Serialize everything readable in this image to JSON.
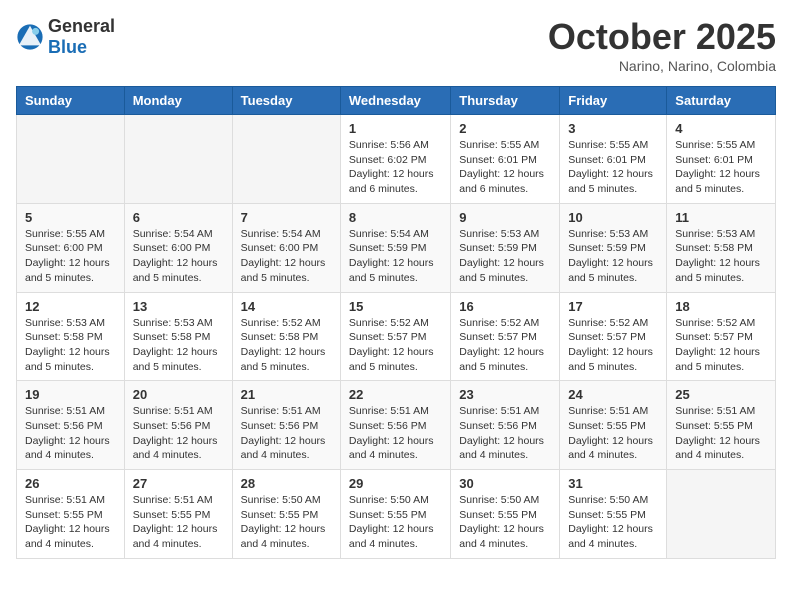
{
  "logo": {
    "text_general": "General",
    "text_blue": "Blue"
  },
  "header": {
    "month_title": "October 2025",
    "location": "Narino, Narino, Colombia"
  },
  "weekdays": [
    "Sunday",
    "Monday",
    "Tuesday",
    "Wednesday",
    "Thursday",
    "Friday",
    "Saturday"
  ],
  "weeks": [
    [
      {
        "day": "",
        "info": ""
      },
      {
        "day": "",
        "info": ""
      },
      {
        "day": "",
        "info": ""
      },
      {
        "day": "1",
        "info": "Sunrise: 5:56 AM\nSunset: 6:02 PM\nDaylight: 12 hours\nand 6 minutes."
      },
      {
        "day": "2",
        "info": "Sunrise: 5:55 AM\nSunset: 6:01 PM\nDaylight: 12 hours\nand 6 minutes."
      },
      {
        "day": "3",
        "info": "Sunrise: 5:55 AM\nSunset: 6:01 PM\nDaylight: 12 hours\nand 5 minutes."
      },
      {
        "day": "4",
        "info": "Sunrise: 5:55 AM\nSunset: 6:01 PM\nDaylight: 12 hours\nand 5 minutes."
      }
    ],
    [
      {
        "day": "5",
        "info": "Sunrise: 5:55 AM\nSunset: 6:00 PM\nDaylight: 12 hours\nand 5 minutes."
      },
      {
        "day": "6",
        "info": "Sunrise: 5:54 AM\nSunset: 6:00 PM\nDaylight: 12 hours\nand 5 minutes."
      },
      {
        "day": "7",
        "info": "Sunrise: 5:54 AM\nSunset: 6:00 PM\nDaylight: 12 hours\nand 5 minutes."
      },
      {
        "day": "8",
        "info": "Sunrise: 5:54 AM\nSunset: 5:59 PM\nDaylight: 12 hours\nand 5 minutes."
      },
      {
        "day": "9",
        "info": "Sunrise: 5:53 AM\nSunset: 5:59 PM\nDaylight: 12 hours\nand 5 minutes."
      },
      {
        "day": "10",
        "info": "Sunrise: 5:53 AM\nSunset: 5:59 PM\nDaylight: 12 hours\nand 5 minutes."
      },
      {
        "day": "11",
        "info": "Sunrise: 5:53 AM\nSunset: 5:58 PM\nDaylight: 12 hours\nand 5 minutes."
      }
    ],
    [
      {
        "day": "12",
        "info": "Sunrise: 5:53 AM\nSunset: 5:58 PM\nDaylight: 12 hours\nand 5 minutes."
      },
      {
        "day": "13",
        "info": "Sunrise: 5:53 AM\nSunset: 5:58 PM\nDaylight: 12 hours\nand 5 minutes."
      },
      {
        "day": "14",
        "info": "Sunrise: 5:52 AM\nSunset: 5:58 PM\nDaylight: 12 hours\nand 5 minutes."
      },
      {
        "day": "15",
        "info": "Sunrise: 5:52 AM\nSunset: 5:57 PM\nDaylight: 12 hours\nand 5 minutes."
      },
      {
        "day": "16",
        "info": "Sunrise: 5:52 AM\nSunset: 5:57 PM\nDaylight: 12 hours\nand 5 minutes."
      },
      {
        "day": "17",
        "info": "Sunrise: 5:52 AM\nSunset: 5:57 PM\nDaylight: 12 hours\nand 5 minutes."
      },
      {
        "day": "18",
        "info": "Sunrise: 5:52 AM\nSunset: 5:57 PM\nDaylight: 12 hours\nand 5 minutes."
      }
    ],
    [
      {
        "day": "19",
        "info": "Sunrise: 5:51 AM\nSunset: 5:56 PM\nDaylight: 12 hours\nand 4 minutes."
      },
      {
        "day": "20",
        "info": "Sunrise: 5:51 AM\nSunset: 5:56 PM\nDaylight: 12 hours\nand 4 minutes."
      },
      {
        "day": "21",
        "info": "Sunrise: 5:51 AM\nSunset: 5:56 PM\nDaylight: 12 hours\nand 4 minutes."
      },
      {
        "day": "22",
        "info": "Sunrise: 5:51 AM\nSunset: 5:56 PM\nDaylight: 12 hours\nand 4 minutes."
      },
      {
        "day": "23",
        "info": "Sunrise: 5:51 AM\nSunset: 5:56 PM\nDaylight: 12 hours\nand 4 minutes."
      },
      {
        "day": "24",
        "info": "Sunrise: 5:51 AM\nSunset: 5:55 PM\nDaylight: 12 hours\nand 4 minutes."
      },
      {
        "day": "25",
        "info": "Sunrise: 5:51 AM\nSunset: 5:55 PM\nDaylight: 12 hours\nand 4 minutes."
      }
    ],
    [
      {
        "day": "26",
        "info": "Sunrise: 5:51 AM\nSunset: 5:55 PM\nDaylight: 12 hours\nand 4 minutes."
      },
      {
        "day": "27",
        "info": "Sunrise: 5:51 AM\nSunset: 5:55 PM\nDaylight: 12 hours\nand 4 minutes."
      },
      {
        "day": "28",
        "info": "Sunrise: 5:50 AM\nSunset: 5:55 PM\nDaylight: 12 hours\nand 4 minutes."
      },
      {
        "day": "29",
        "info": "Sunrise: 5:50 AM\nSunset: 5:55 PM\nDaylight: 12 hours\nand 4 minutes."
      },
      {
        "day": "30",
        "info": "Sunrise: 5:50 AM\nSunset: 5:55 PM\nDaylight: 12 hours\nand 4 minutes."
      },
      {
        "day": "31",
        "info": "Sunrise: 5:50 AM\nSunset: 5:55 PM\nDaylight: 12 hours\nand 4 minutes."
      },
      {
        "day": "",
        "info": ""
      }
    ]
  ]
}
